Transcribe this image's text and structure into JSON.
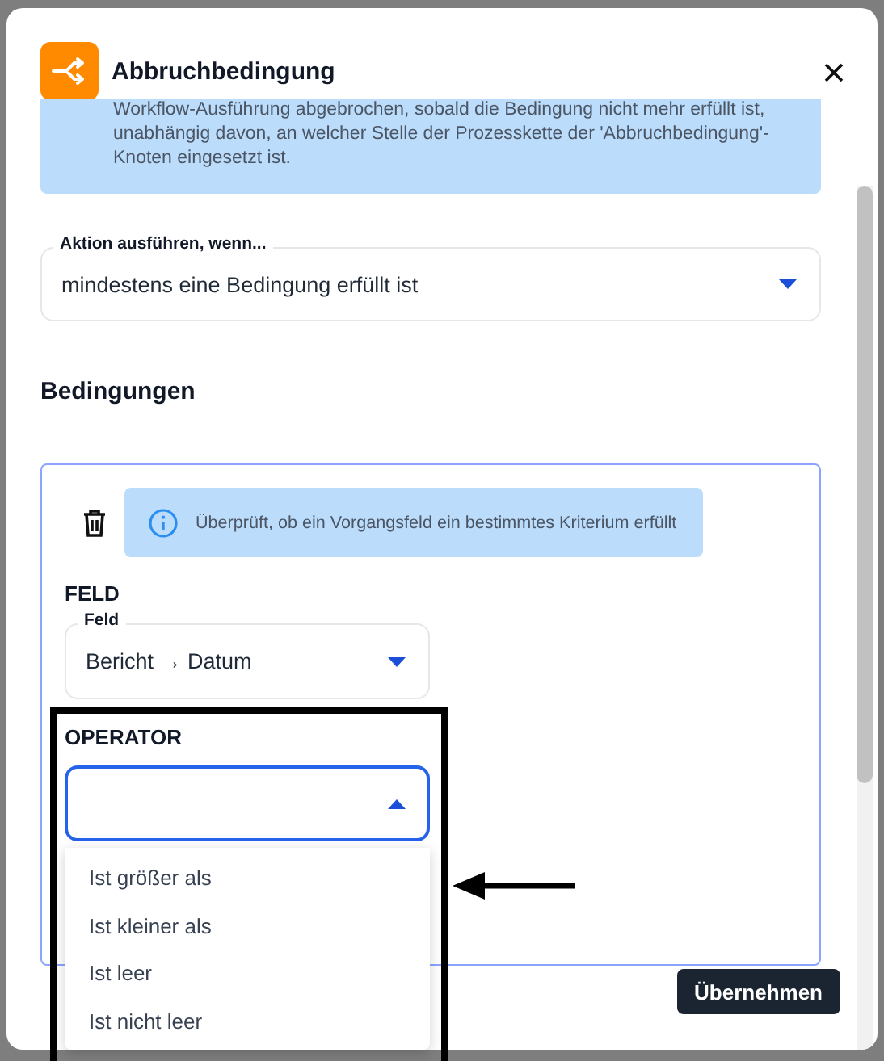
{
  "dialog": {
    "title": "Abbruchbedingung",
    "info_text": "Workflow-Ausführung abgebrochen, sobald die Bedingung nicht mehr erfüllt ist, unabhängig davon, an welcher Stelle der Prozesskette der 'Abbruchbedingung'-Knoten eingesetzt ist.",
    "action_select": {
      "label": "Aktion ausführen, wenn...",
      "value": "mindestens eine Bedingung erfüllt ist",
      "expanded": false
    },
    "conditions_heading": "Bedingungen",
    "conditions": [
      {
        "info_text": "Überprüft, ob ein Vorgangsfeld ein bestimmtes Kriterium erfüllt",
        "field_heading": "FELD",
        "field_select": {
          "label": "Feld",
          "value": "Bericht → Datum",
          "expanded": false
        },
        "operator_heading": "OPERATOR",
        "operator_select": {
          "expanded": true,
          "options": [
            "Ist größer als",
            "Ist kleiner als",
            "Ist leer",
            "Ist nicht leer"
          ]
        }
      }
    ],
    "apply_button": "Übernehmen"
  }
}
